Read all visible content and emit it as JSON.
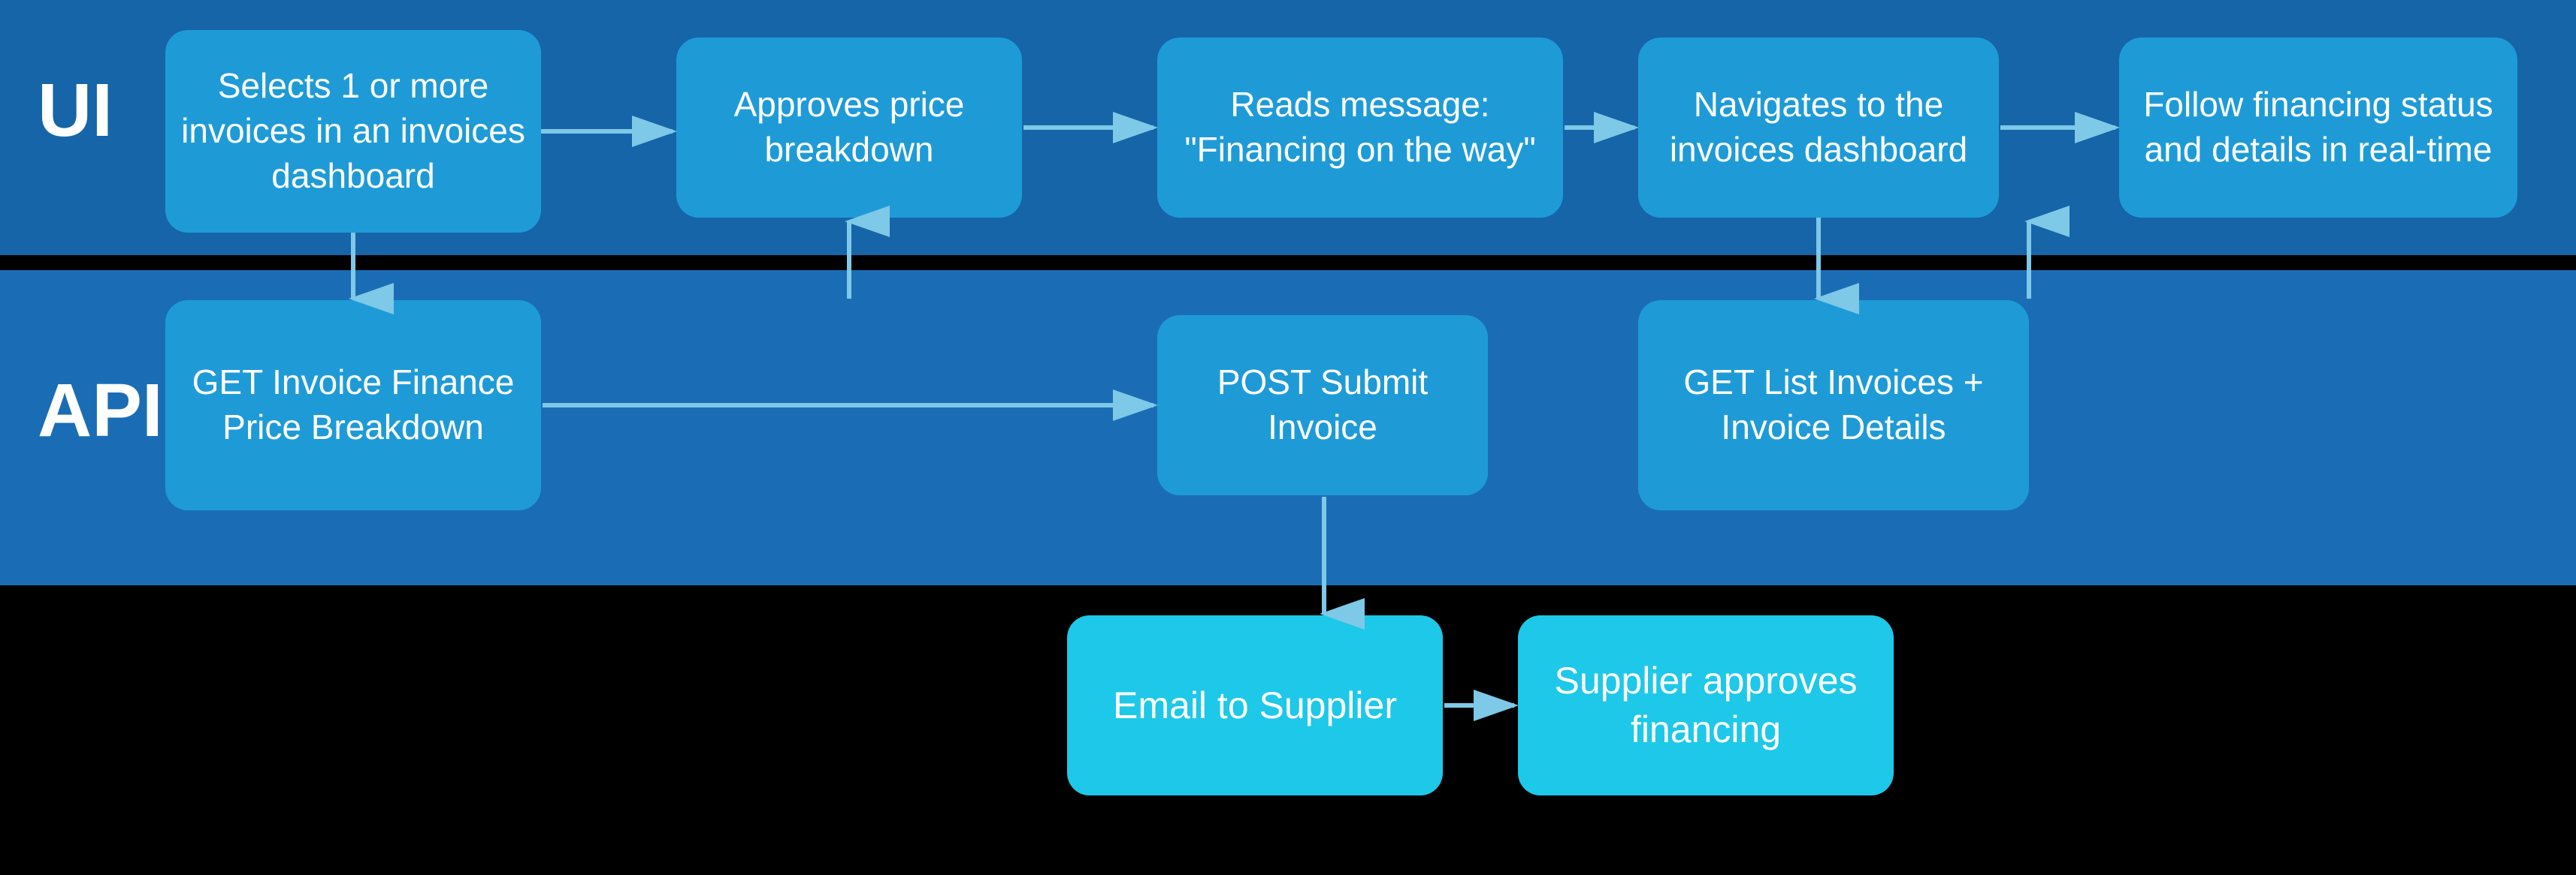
{
  "labels": {
    "ui": "UI",
    "api": "API"
  },
  "ui_nodes": [
    {
      "id": "ui-n1",
      "text": "Selects 1 or more invoices in an invoices dashboard"
    },
    {
      "id": "ui-n2",
      "text": "Approves price breakdown"
    },
    {
      "id": "ui-n3",
      "text": "Reads message: \"Financing on the way\""
    },
    {
      "id": "ui-n4",
      "text": "Navigates to the invoices dashboard"
    },
    {
      "id": "ui-n5",
      "text": "Follow financing status and details in real-time"
    }
  ],
  "api_nodes": [
    {
      "id": "api-n1",
      "text": "GET Invoice Finance Price Breakdown"
    },
    {
      "id": "api-n2",
      "text": "POST Submit Invoice"
    },
    {
      "id": "api-n3",
      "text": "GET List Invoices + Invoice Details"
    }
  ],
  "bottom_nodes": [
    {
      "id": "bot-n1",
      "text": "Email to Supplier"
    },
    {
      "id": "bot-n2",
      "text": "Supplier approves financing"
    }
  ],
  "colors": {
    "bg": "#000000",
    "ui_band": "#1565a8",
    "api_band": "#1a6db5",
    "node": "#1e9bd7",
    "bottom_node": "#1ec8e8",
    "arrow": "#7ec8e8",
    "label_text": "#ffffff"
  }
}
